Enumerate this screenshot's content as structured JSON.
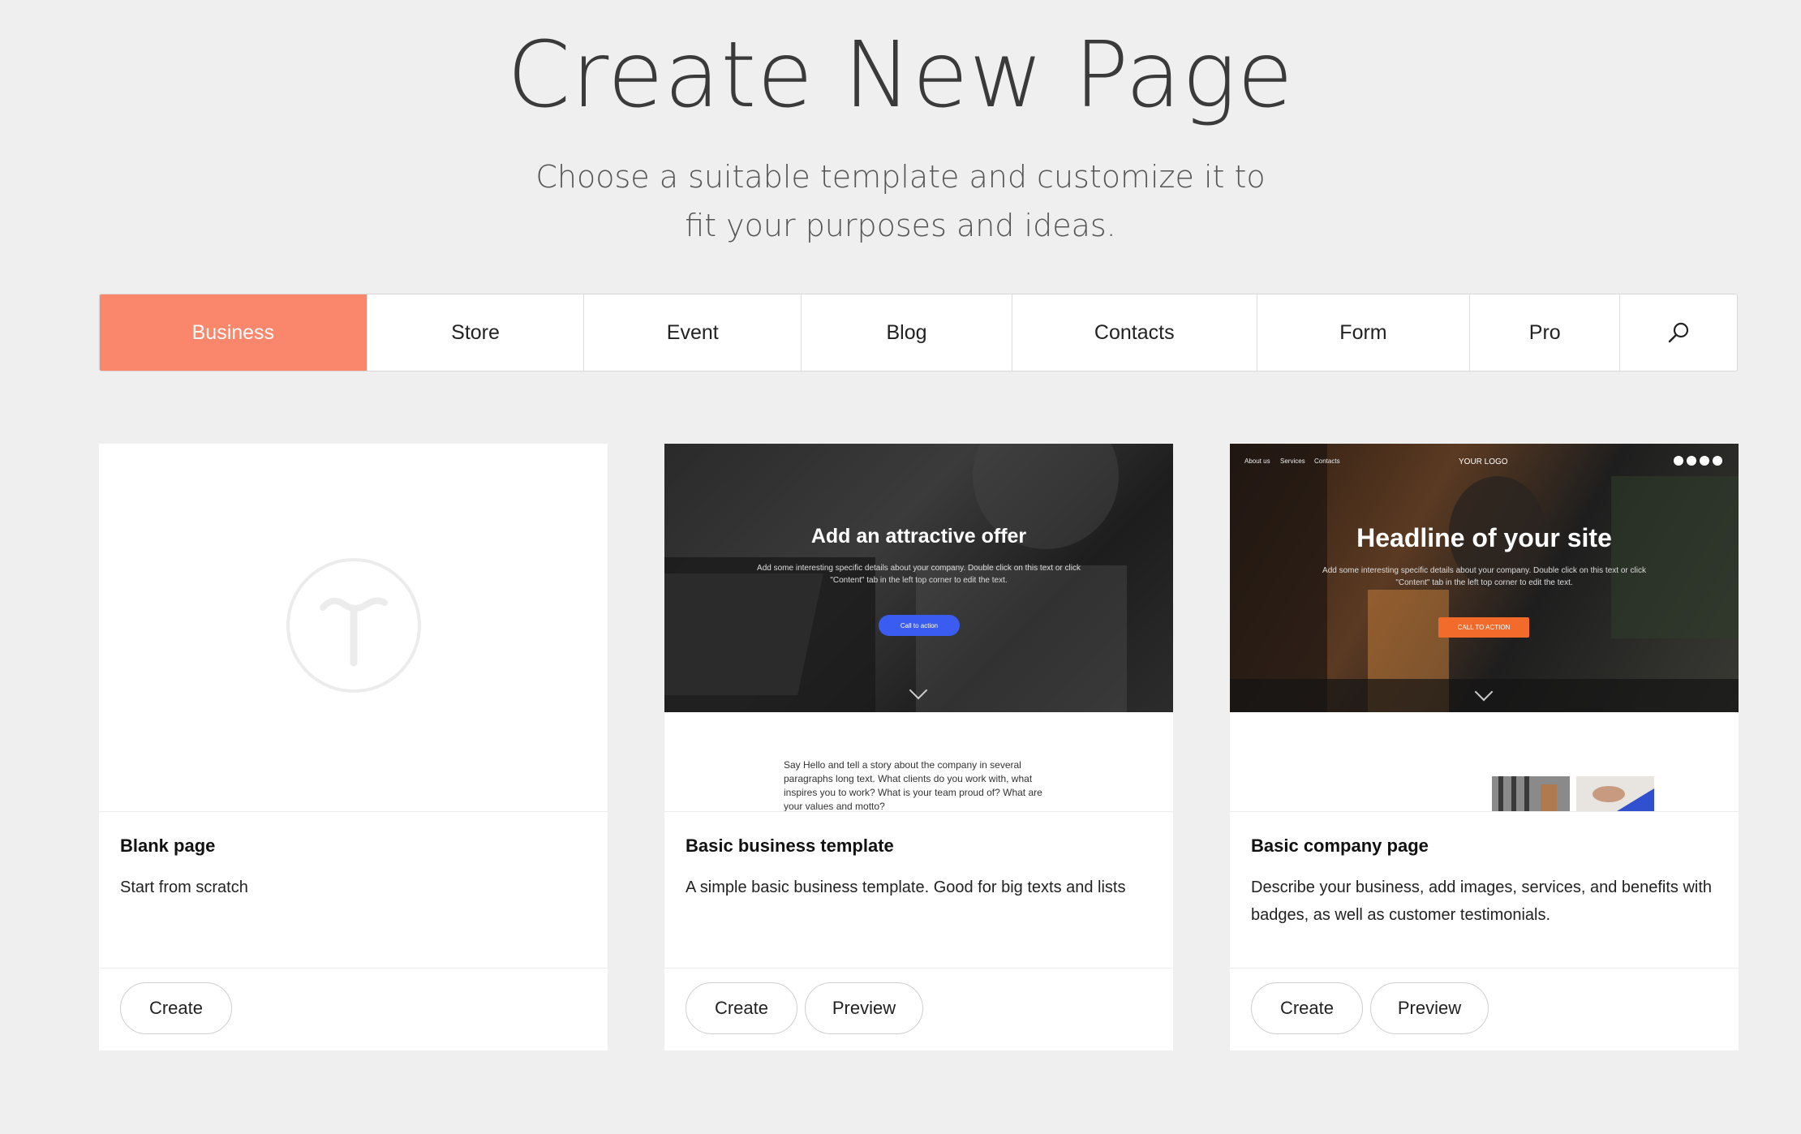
{
  "header": {
    "title": "Create New Page",
    "subtitle": "Choose a suitable template and customize it to fit your purposes and ideas."
  },
  "tabs": [
    {
      "label": "Business",
      "active": true
    },
    {
      "label": "Store",
      "active": false
    },
    {
      "label": "Event",
      "active": false
    },
    {
      "label": "Blog",
      "active": false
    },
    {
      "label": "Contacts",
      "active": false
    },
    {
      "label": "Form",
      "active": false
    },
    {
      "label": "Pro",
      "active": false
    }
  ],
  "search_icon": "search-icon",
  "colors": {
    "accent": "#fa876b",
    "background": "#efefef",
    "cta_blue": "#3a5cf0",
    "cta_orange": "#f26b2b"
  },
  "cards": [
    {
      "name": "Blank page",
      "description": "Start from scratch",
      "create_label": "Create",
      "preview_icon": "tilda-logo-icon"
    },
    {
      "name": "Basic business template",
      "description": "A simple basic business template. Good for big texts and lists",
      "create_label": "Create",
      "preview_label": "Preview",
      "preview": {
        "headline": "Add an attractive offer",
        "body": "Add some interesting specific details about your company. Double click on this text or click \"Content\" tab in the left top corner to edit the text.",
        "cta": "Call to action",
        "story": "Say Hello and tell a story about the company in several paragraphs long text. What clients do you work with, what inspires you to work? What is your team proud of? What are your values and motto?"
      }
    },
    {
      "name": "Basic company page",
      "description": "Describe your business, add images, services, and benefits with badges, as well as customer testimonials.",
      "create_label": "Create",
      "preview_label": "Preview",
      "preview": {
        "nav": [
          "About us",
          "Services",
          "Contacts"
        ],
        "logo": "YOUR LOGO",
        "headline": "Headline of your site",
        "body": "Add some interesting specific details about your company. Double click on this text or click \"Content\" tab in the left top corner to edit the text.",
        "cta": "CALL TO ACTION"
      }
    }
  ]
}
